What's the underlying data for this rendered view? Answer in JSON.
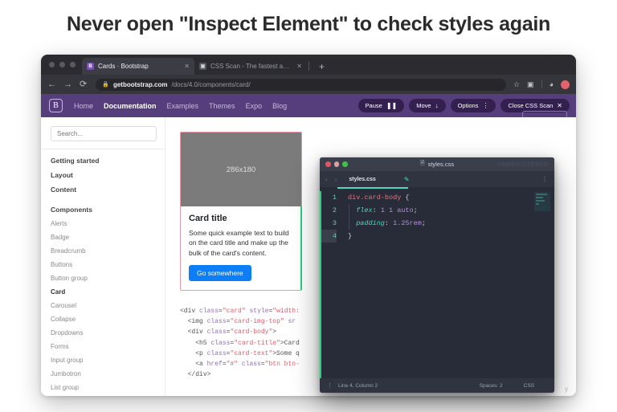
{
  "headline": "Never open \"Inspect Element\" to check styles again",
  "browser": {
    "tabs": [
      {
        "favicon": "B",
        "title": "Cards · Bootstrap",
        "active": true,
        "close": "✕"
      },
      {
        "favicon": "▣",
        "title": "CSS Scan - The fastest and ea",
        "active": false,
        "close": "✕"
      }
    ],
    "new_tab_label": "+",
    "nav": {
      "back": "←",
      "forward": "→",
      "reload": "⟳"
    },
    "omnibox": {
      "lock_icon": "lock-icon",
      "url_domain": "getbootstrap.com",
      "url_path": "/docs/4.0/components/card/",
      "star_icon": "☆",
      "extension_icon": "▣"
    }
  },
  "bootstrap_nav": {
    "logo": "B",
    "links": [
      {
        "label": "Home",
        "current": false
      },
      {
        "label": "Documentation",
        "current": true
      },
      {
        "label": "Examples",
        "current": false
      },
      {
        "label": "Themes",
        "current": false
      },
      {
        "label": "Expo",
        "current": false
      },
      {
        "label": "Blog",
        "current": false
      }
    ]
  },
  "css_scan_toolbar": {
    "pause": {
      "label": "Pause",
      "icon": "❚❚"
    },
    "move": {
      "label": "Move",
      "icon": "↓"
    },
    "options": {
      "label": "Options",
      "icon": "⋮"
    },
    "close": {
      "label": "Close CSS Scan",
      "icon": "✕"
    }
  },
  "sidebar": {
    "search_placeholder": "Search...",
    "top_items": [
      "Getting started",
      "Layout",
      "Content"
    ],
    "components_heading": "Components",
    "components": [
      {
        "label": "Alerts",
        "current": false
      },
      {
        "label": "Badge",
        "current": false
      },
      {
        "label": "Breadcrumb",
        "current": false
      },
      {
        "label": "Buttons",
        "current": false
      },
      {
        "label": "Button group",
        "current": false
      },
      {
        "label": "Card",
        "current": true
      },
      {
        "label": "Carousel",
        "current": false
      },
      {
        "label": "Collapse",
        "current": false
      },
      {
        "label": "Dropdowns",
        "current": false
      },
      {
        "label": "Forms",
        "current": false
      },
      {
        "label": "Input group",
        "current": false
      },
      {
        "label": "Jumbotron",
        "current": false
      },
      {
        "label": "List group",
        "current": false
      }
    ]
  },
  "card": {
    "image_placeholder": "286x180",
    "title": "Card title",
    "text": "Some quick example text to build on the card title and make up the bulk of the card's content.",
    "button_label": "Go somewhere",
    "highlight_color": "#e89aab",
    "accent_color": "#26d07c",
    "button_color": "#0d7ef5"
  },
  "html_code": {
    "lines": [
      "<div class=\"card\" style=\"width:",
      "  <img class=\"card-img-top\" sr",
      "  <div class=\"card-body\">",
      "    <h5 class=\"card-title\">Card",
      "    <p class=\"card-text\">Some q",
      "    <a href=\"#\" class=\"btn btn-",
      "  </div>"
    ],
    "trailing_text": "y"
  },
  "editor": {
    "window_title": "styles.css",
    "doc_icon": "document-icon",
    "unregistered_badge": "UNREGISTERED",
    "tab_name": "styles.css",
    "pencil_icon": "✎",
    "kebab_icon": "⋮",
    "nav_prev": "‹",
    "nav_next": "›",
    "code_lines": [
      {
        "num": "1",
        "active": false,
        "tokens": [
          {
            "t": "div.card-body",
            "c": "sel"
          },
          {
            "t": " ",
            "c": "punct"
          },
          {
            "t": "{",
            "c": "brace"
          }
        ]
      },
      {
        "num": "2",
        "active": false,
        "tokens": [
          {
            "t": "  ",
            "c": "punct"
          },
          {
            "t": "flex",
            "c": "prop"
          },
          {
            "t": ": ",
            "c": "punct"
          },
          {
            "t": "1 1 auto",
            "c": "val"
          },
          {
            "t": ";",
            "c": "punct"
          }
        ]
      },
      {
        "num": "3",
        "active": false,
        "tokens": [
          {
            "t": "  ",
            "c": "punct"
          },
          {
            "t": "padding",
            "c": "prop"
          },
          {
            "t": ": ",
            "c": "punct"
          },
          {
            "t": "1.25rem",
            "c": "val"
          },
          {
            "t": ";",
            "c": "punct"
          }
        ]
      },
      {
        "num": "4",
        "active": true,
        "tokens": [
          {
            "t": "}",
            "c": "brace"
          }
        ]
      }
    ],
    "status": {
      "kebab": "⋮",
      "cursor": "Line 4, Column 2",
      "indent": "Spaces: 2",
      "language": "CSS"
    }
  }
}
